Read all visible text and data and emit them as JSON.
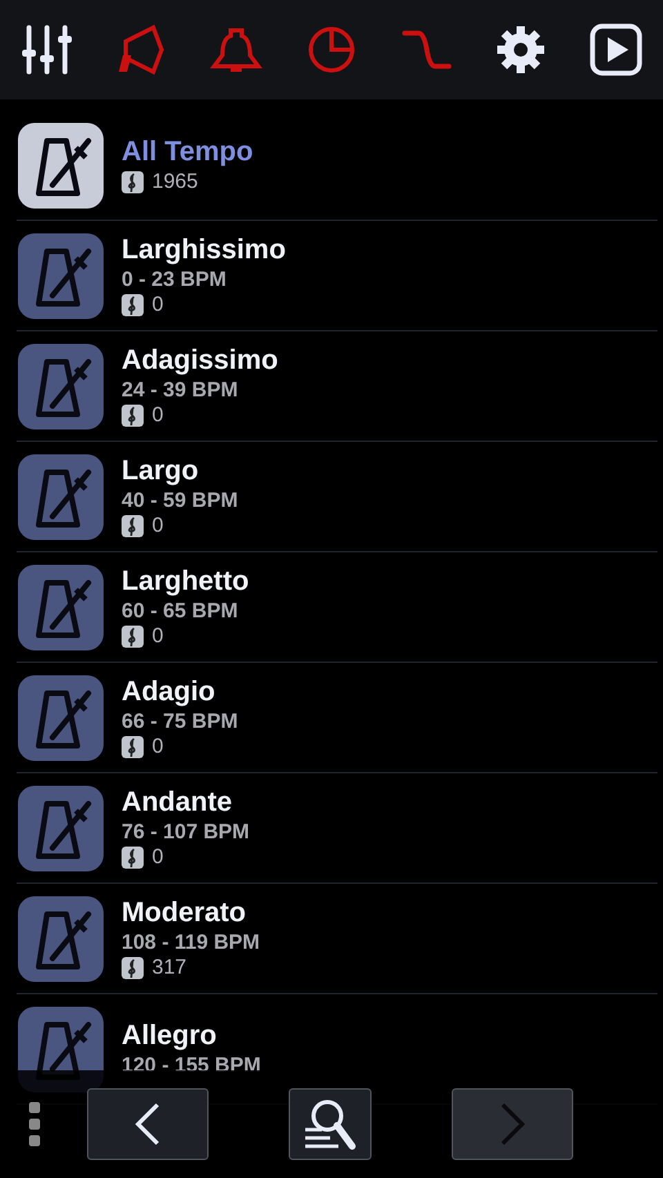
{
  "tempos": [
    {
      "name": "All Tempo",
      "selected": true,
      "count": "1965"
    },
    {
      "name": "Larghissimo",
      "selected": false,
      "range": "0 - 23 BPM",
      "count": "0"
    },
    {
      "name": "Adagissimo",
      "selected": false,
      "range": "24 - 39 BPM",
      "count": "0"
    },
    {
      "name": "Largo",
      "selected": false,
      "range": "40 - 59 BPM",
      "count": "0"
    },
    {
      "name": "Larghetto",
      "selected": false,
      "range": "60 - 65 BPM",
      "count": "0"
    },
    {
      "name": "Adagio",
      "selected": false,
      "range": "66 - 75 BPM",
      "count": "0"
    },
    {
      "name": "Andante",
      "selected": false,
      "range": "76 - 107 BPM",
      "count": "0"
    },
    {
      "name": "Moderato",
      "selected": false,
      "range": "108 - 119 BPM",
      "count": "317"
    },
    {
      "name": "Allegro",
      "selected": false,
      "range": "120 - 155 BPM"
    }
  ]
}
